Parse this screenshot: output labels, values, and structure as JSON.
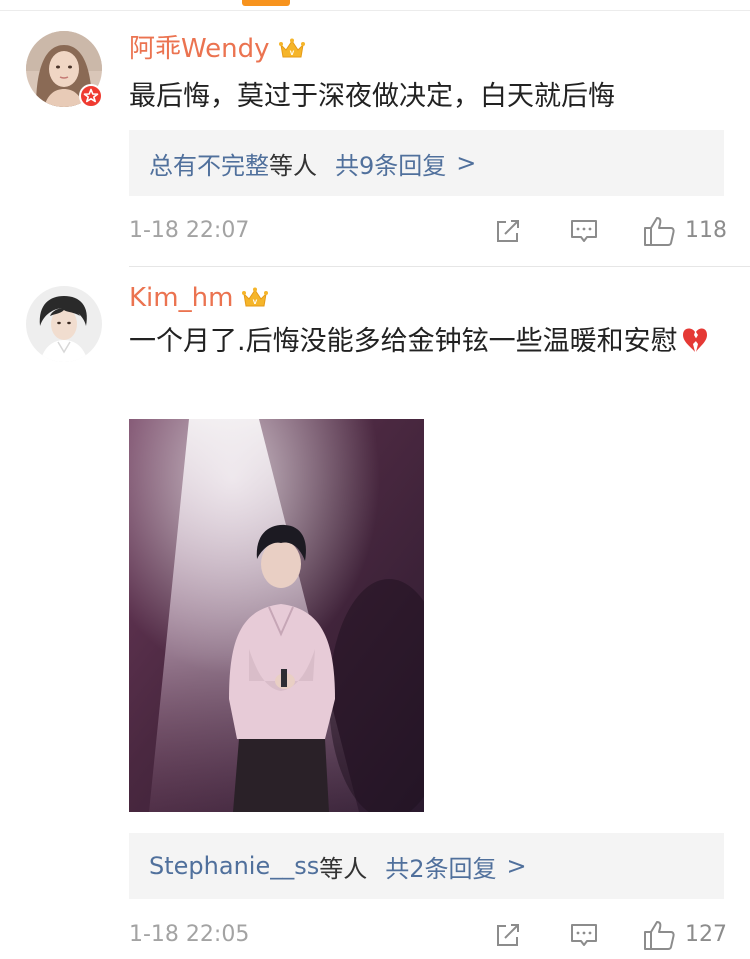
{
  "comments": [
    {
      "username": "阿乖Wendy",
      "text": "最后悔，莫过于深夜做决定，白天就后悔",
      "reply_users": "总有不完整",
      "reply_suffix": "等人",
      "reply_count": "共9条回复",
      "reply_arrow": ">",
      "timestamp": "1-18 22:07",
      "likes": "118",
      "has_verified_badge": true,
      "avatar": "woman-portrait-avatar"
    },
    {
      "username": "Kim_hm",
      "text": "一个月了.后悔没能多给金钟铉一些温暖和安慰",
      "reply_users": "Stephanie__ss",
      "reply_suffix": "等人",
      "reply_count": "共2条回复",
      "reply_arrow": ">",
      "timestamp": "1-18 22:05",
      "likes": "127",
      "has_verified_badge": false,
      "avatar": "man-portrait-avatar",
      "attached_image": "stage-performer-photo"
    }
  ],
  "colors": {
    "username": "#eb7350",
    "link": "#50709c",
    "accent": "#f7931e",
    "meta": "#a3a3a3",
    "reply_bg": "#f4f4f4"
  },
  "icons": [
    "crown-icon",
    "broken-heart-icon",
    "share-icon",
    "comment-icon",
    "like-icon"
  ]
}
